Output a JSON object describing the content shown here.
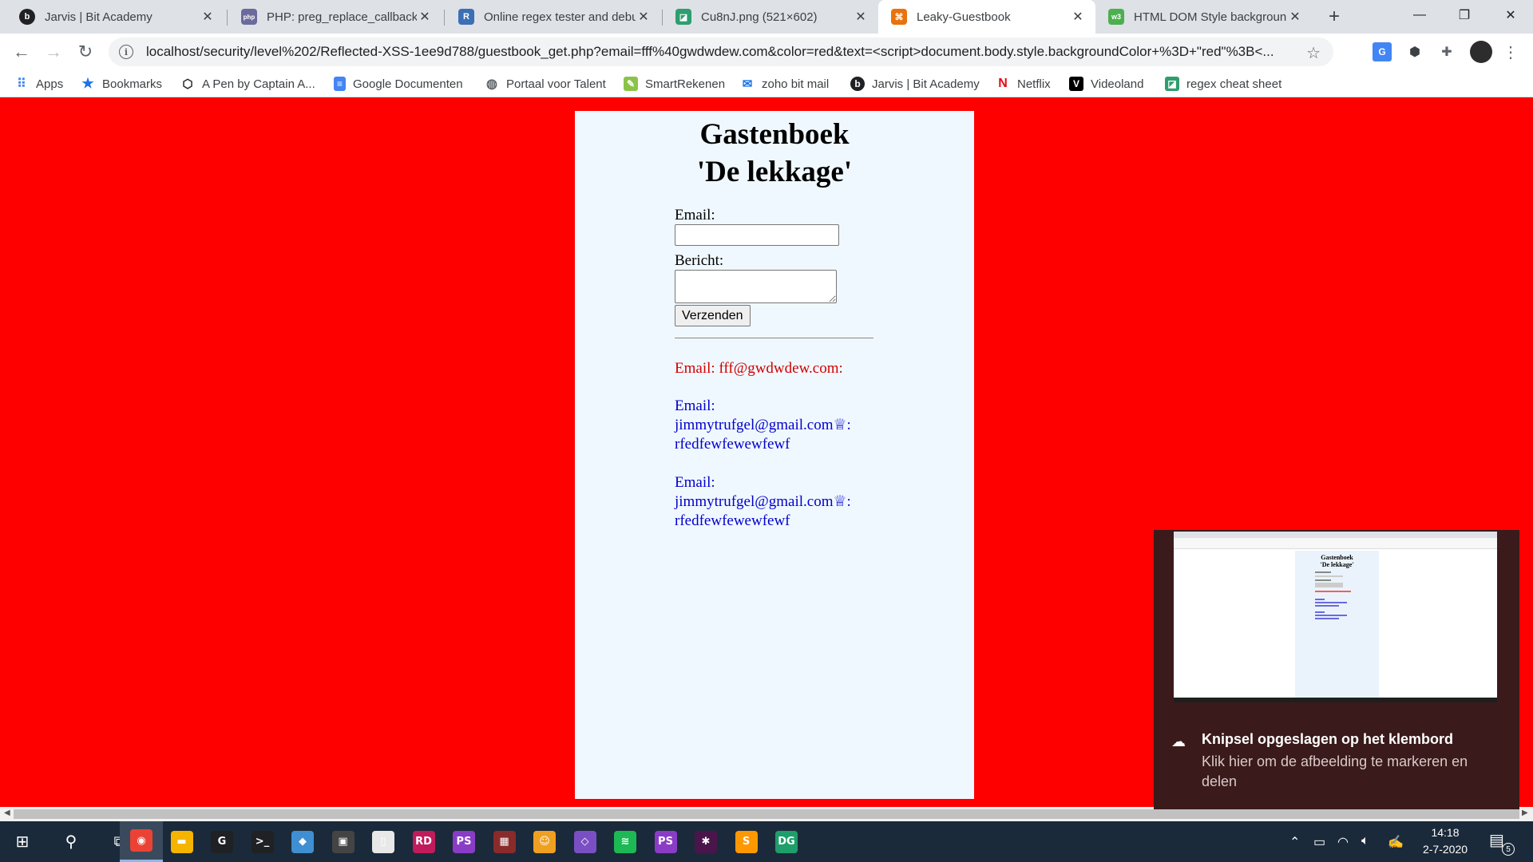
{
  "browser": {
    "tabs": [
      {
        "title": "Jarvis | Bit Academy",
        "favicon": "b",
        "favicon_color": "#202124",
        "active": false
      },
      {
        "title": "PHP: preg_replace_callback - ",
        "favicon": "php",
        "favicon_color": "#6a6a9c",
        "active": false
      },
      {
        "title": "Online regex tester and debu",
        "favicon": "R",
        "favicon_color": "#3b6fb6",
        "active": false
      },
      {
        "title": "Cu8nJ.png (521×602)",
        "favicon": "◪",
        "favicon_color": "#2e9e6e",
        "active": false
      },
      {
        "title": "Leaky-Guestbook",
        "favicon": "⌘",
        "favicon_color": "#e8730c",
        "active": true
      },
      {
        "title": "HTML DOM Style backgroun",
        "favicon": "w3",
        "favicon_color": "#4caf50",
        "active": false
      }
    ],
    "new_tab_icon": "+",
    "window_controls": {
      "minimize": "—",
      "restore": "❐",
      "close": "✕"
    },
    "url": "localhost/security/level%202/Reflected-XSS-1ee9d788/guestbook_get.php?email=fff%40gwdwdew.com&color=red&text=<script>document.body.style.backgroundColor+%3D+\"red\"%3B<...",
    "bookmarks": [
      {
        "label": "Apps",
        "icon": "apps-grid-icon",
        "color": "#4285f4"
      },
      {
        "label": "Bookmarks",
        "icon": "star-icon",
        "color": "#1a73e8"
      },
      {
        "label": "A Pen by Captain A...",
        "icon": "codepen-icon",
        "color": "#202124"
      },
      {
        "label": "Google Documenten",
        "icon": "docs-icon",
        "color": "#4285f4"
      },
      {
        "label": "Portaal voor Talent",
        "icon": "globe-icon",
        "color": "#5f6368"
      },
      {
        "label": "SmartRekenen",
        "icon": "smartrekenen-icon",
        "color": "#8bc34a"
      },
      {
        "label": "zoho bit mail",
        "icon": "mail-icon",
        "color": "#1a73e8"
      },
      {
        "label": "Jarvis | Bit Academy",
        "icon": "bit-academy-icon",
        "color": "#202124"
      },
      {
        "label": "Netflix",
        "icon": "netflix-icon",
        "color": "#e50914"
      },
      {
        "label": "Videoland",
        "icon": "videoland-icon",
        "color": "#000000"
      },
      {
        "label": "regex cheat sheet",
        "icon": "regex-icon",
        "color": "#2e9e6e"
      }
    ]
  },
  "page": {
    "background": "#ff0000",
    "title_line1": "Gastenboek",
    "title_line2": "'De lekkage'",
    "form": {
      "email_label": "Email:",
      "email_value": "",
      "message_label": "Bericht:",
      "message_value": "",
      "submit_label": "Verzenden"
    },
    "entries": [
      {
        "line1": "Email: fff@gwdwdew.com:",
        "line2": "",
        "line3": "",
        "color": "#d00000"
      },
      {
        "line1": "Email:",
        "line2": "jimmytrufgel@gmail.com♕:",
        "line3": "rfedfewfewewfewf",
        "color": "#0000cc"
      },
      {
        "line1": "Email:",
        "line2": "jimmytrufgel@gmail.com♕:",
        "line3": "rfedfewfewewfewf",
        "color": "#0000cc"
      }
    ]
  },
  "toast": {
    "title": "Knipsel opgeslagen op het klembord",
    "body": "Klik hier om de afbeelding te markeren en delen",
    "thumbnail_heading_line1": "Gastenboek",
    "thumbnail_heading_line2": "'De lekkage'"
  },
  "taskbar": {
    "apps": [
      {
        "name": "chrome",
        "label": "◉",
        "color": "#ea4335",
        "active": true
      },
      {
        "name": "file-explorer",
        "label": "▬",
        "color": "#f4b400",
        "active": false
      },
      {
        "name": "logitech-g-hub",
        "label": "G",
        "color": "#202124",
        "active": false
      },
      {
        "name": "terminal",
        "label": ">_",
        "color": "#202124",
        "active": false
      },
      {
        "name": "git-kraken",
        "label": "◆",
        "color": "#3f8fd2",
        "active": false
      },
      {
        "name": "game-controller",
        "label": "▣",
        "color": "#444",
        "active": false
      },
      {
        "name": "notepad",
        "label": "▯",
        "color": "#e8e8e8",
        "active": false
      },
      {
        "name": "rider",
        "label": "RD",
        "color": "#c21b5c",
        "active": false
      },
      {
        "name": "phpstorm",
        "label": "PS",
        "color": "#8b3cc7",
        "active": false
      },
      {
        "name": "winrar",
        "label": "▦",
        "color": "#8a2b2b",
        "active": false
      },
      {
        "name": "discord",
        "label": "☺",
        "color": "#f0a020",
        "active": false
      },
      {
        "name": "visual-studio",
        "label": "◇",
        "color": "#7b4fc4",
        "active": false
      },
      {
        "name": "spotify",
        "label": "≋",
        "color": "#1db954",
        "active": false
      },
      {
        "name": "phpstorm-2",
        "label": "PS",
        "color": "#8b3cc7",
        "active": false
      },
      {
        "name": "slack",
        "label": "✱",
        "color": "#4a154b",
        "active": false
      },
      {
        "name": "sublime-text",
        "label": "S",
        "color": "#ff9800",
        "active": false
      },
      {
        "name": "datagrip",
        "label": "DG",
        "color": "#1e9e6a",
        "active": false
      }
    ],
    "time": "14:18",
    "date": "2-7-2020",
    "notification_count": "5"
  }
}
